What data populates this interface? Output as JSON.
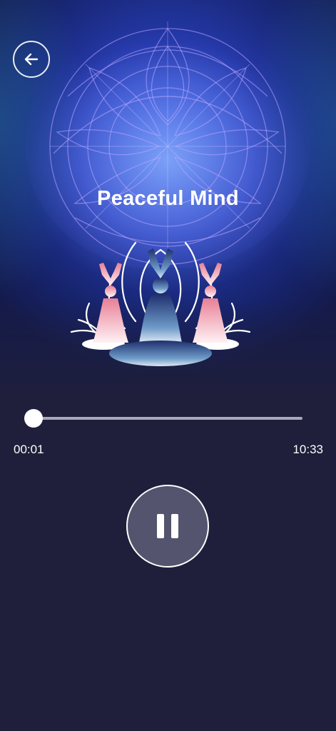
{
  "player": {
    "title": "Peaceful Mind",
    "elapsed": "00:01",
    "duration": "10:33",
    "progress_fraction": 0.002,
    "state": "playing"
  },
  "icons": {
    "back": "arrow-left-icon",
    "pause": "pause-icon"
  },
  "colors": {
    "background": "#1f1f3c",
    "hero_blue": "#2338a8",
    "accent_pink": "#f2b7c2",
    "button_fill": "#54546e",
    "track": "#a9a9b9",
    "text": "#ffffff"
  }
}
